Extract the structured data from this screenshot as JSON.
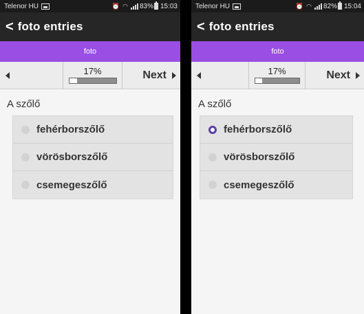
{
  "screens": [
    {
      "status": {
        "carrier": "Telenor HU",
        "battery": "83%",
        "time": "15:03"
      },
      "app_title": "foto entries",
      "form_title": "foto",
      "progress": {
        "label": "17%",
        "fraction": 0.17
      },
      "next_label": "Next",
      "question": "A szőlő",
      "choices": [
        {
          "label": "fehérborszőlő",
          "selected": false
        },
        {
          "label": "vörösborszőlő",
          "selected": false
        },
        {
          "label": "csemegeszőlő",
          "selected": false
        }
      ]
    },
    {
      "status": {
        "carrier": "Telenor HU",
        "battery": "82%",
        "time": "15:04"
      },
      "app_title": "foto entries",
      "form_title": "foto",
      "progress": {
        "label": "17%",
        "fraction": 0.17
      },
      "next_label": "Next",
      "question": "A szőlő",
      "choices": [
        {
          "label": "fehérborszőlő",
          "selected": true
        },
        {
          "label": "vörösborszőlő",
          "selected": false
        },
        {
          "label": "csemegeszőlő",
          "selected": false
        }
      ]
    }
  ],
  "colors": {
    "form_bar": "#9a4ee3",
    "app_bar": "#262626",
    "radio_selected": "#5b3fa8"
  },
  "icons": [
    "back-arrow-icon",
    "prev-arrow-icon",
    "next-arrow-icon",
    "alarm-icon",
    "wifi-icon",
    "signal-icon",
    "battery-icon",
    "sim-icon"
  ]
}
